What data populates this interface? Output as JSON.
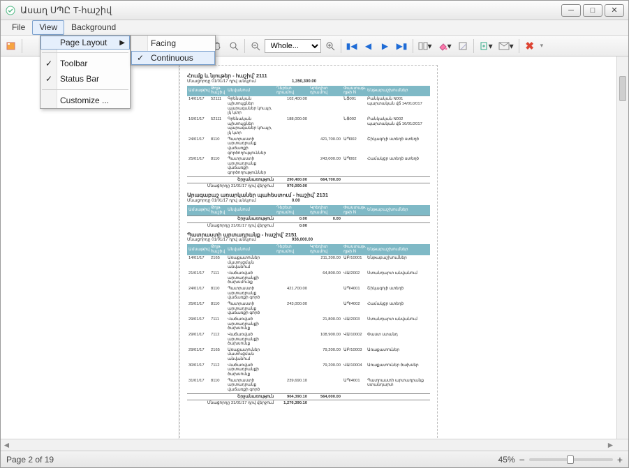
{
  "window": {
    "title": "Ասաղ ՍՊԸ T-հաշիվ"
  },
  "menubar": {
    "file": "File",
    "view": "View",
    "background": "Background"
  },
  "view_menu": {
    "page_layout": "Page Layout",
    "facing": "Facing",
    "continuous": "Continuous",
    "toolbar": "Toolbar",
    "statusbar": "Status Bar",
    "customize": "Customize ..."
  },
  "toolbar": {
    "zoom_select": "Whole...",
    "close_tooltip": "Close"
  },
  "statusbar": {
    "page_info": "Page 2 of 19",
    "zoom_pct": "45%"
  },
  "doc": {
    "sections": [
      {
        "title": "Հումք և նյութեր - հաշիվ՝ 2111",
        "opening_label": "Մնացորդը 01/01/17 դրվ անկյում",
        "opening_amount": "1,350,300.00",
        "headers": [
          "Ամսաթիվ",
          "Թղթ. հաշիվ",
          "Անվանում",
          "Դեբետ դրամով",
          "Կրեդիտ դրամով",
          "Փաստաթ. ղթի N",
          "Ենթաբաշխումներ"
        ],
        "rows": [
          {
            "date": "14/01/17",
            "acc": "52111",
            "name": "Գրենական պիտույքներ պարագաներ կուպր, լկ կտր",
            "debit": "102,400.00",
            "credit": "",
            "doc": "ՆՑ001",
            "sub": "Բանկական N001 պարտական վճ 14/01/2017"
          },
          {
            "date": "16/01/17",
            "acc": "52111",
            "name": "Գրենական պիտույքներ պարագաներ կուպր, լկ կտր",
            "debit": "188,000.00",
            "credit": "",
            "doc": "ՆՑ002",
            "sub": "Բանկական N002 պարտական վճ 16/01/2017"
          },
          {
            "date": "24/01/17",
            "acc": "8110",
            "name": "Պատրաստի արտադրանք վաճառքի գործողություններ",
            "debit": "",
            "credit": "421,700.00",
            "doc": "ԱՊ002",
            "sub": "Շիկագոյի ստեղծ ստեղծ"
          },
          {
            "date": "25/01/17",
            "acc": "8110",
            "name": "Պատրաստի արտադրանք վաճառքի գործողություններ",
            "debit": "",
            "credit": "243,000.00",
            "doc": "ԱՊ002",
            "sub": "Համակցր ստեղծ ստեղծ"
          }
        ],
        "totals_label": "Շրջանառություն",
        "t_debit": "290,400.00",
        "t_credit": "664,700.00",
        "closing_label": "Մնացորդը 31/01/17 դրվ վերջում",
        "closing_amount": "976,000.00"
      },
      {
        "title": "Արագաբաշ առարկաներ պահեստում - հաշիվ՝ 2131",
        "opening_label": "Մնացորդը 01/01/17 դրվ անկյում",
        "opening_amount": "0.00",
        "headers": [
          "Ամսաթիվ",
          "Թղթ. հաշիվ",
          "Անվանում",
          "Դեբետ դրամով",
          "Կրեդիտ դրամով",
          "Փաստաթ. ղթի N",
          "Ենթաբաշխումներ"
        ],
        "rows": [],
        "totals_label": "Շրջանառություն",
        "t_debit": "0.00",
        "t_credit": "0.00",
        "closing_label": "Մնացորդը 31/01/17 դրվ վերջում",
        "closing_amount": "0.00"
      },
      {
        "title": "Պատրաստի արտադրանք - հաշիվ՝ 2151",
        "opening_label": "Մնացորդը 01/01/17 դրվ անկյում",
        "opening_amount": "936,000.00",
        "headers": [
          "Ամսաթիվ",
          "Թղթ. հաշիվ",
          "Անվանում",
          "Դեբետ դրամով",
          "Կրեդիտ դրամով",
          "Փաստաթ. ղթի N",
          "Ենթաբաշխումներ"
        ],
        "rows": [
          {
            "date": "14/01/17",
            "acc": "2165",
            "name": "Առաքատուներ մատուցման անվանում",
            "debit": "",
            "credit": "211,200.00",
            "doc": "ԱԲ/10001",
            "sub": "Ենթաբաշխումներ"
          },
          {
            "date": "21/01/17",
            "acc": "7111",
            "name": "Վաճառված արտադրանքի ծախսմունք",
            "debit": "",
            "credit": "64,800.00",
            "doc": "ՎԱ/2002",
            "sub": "Ստանդարտ անվանում"
          },
          {
            "date": "24/01/17",
            "acc": "8110",
            "name": "Պատրաստի արտադրանք վաճառքի գործ",
            "debit": "421,700.00",
            "credit": "",
            "doc": "ԱՊ/4001",
            "sub": "Շիկագոյի ստեղծ"
          },
          {
            "date": "25/01/17",
            "acc": "8110",
            "name": "Պատրաստի արտադրանք վաճառքի գործ",
            "debit": "243,000.00",
            "credit": "",
            "doc": "ԱՊ/4002",
            "sub": "Համակցր ստեղծ"
          },
          {
            "date": "29/01/17",
            "acc": "7111",
            "name": "Վաճառված արտադրանքի ծախսունք",
            "debit": "",
            "credit": "21,800.00",
            "doc": "ՎԱ/2003",
            "sub": "Ստանդարտ անվանում"
          },
          {
            "date": "29/01/17",
            "acc": "7112",
            "name": "Վաճառված արտադրանքի ծախսունք",
            "debit": "",
            "credit": "108,900.00",
            "doc": "ՎԱ/10002",
            "sub": "Փաստ ստանդ"
          },
          {
            "date": "29/01/17",
            "acc": "2165",
            "name": "Առաքատուներ մատուցման անվանում",
            "debit": "",
            "credit": "79,200.00",
            "doc": "ԱԲ/10003",
            "sub": "Առաքատուներ"
          },
          {
            "date": "30/01/17",
            "acc": "7112",
            "name": "Վաճառված արտադրանքի ծախսունք",
            "debit": "",
            "credit": "79,200.00",
            "doc": "ՎԱ/10004",
            "sub": "Առաքատուներ ծախսեր"
          },
          {
            "date": "31/01/17",
            "acc": "8110",
            "name": "Պատրաստի արտադրանք վաճառքի գործ",
            "debit": "239,690.10",
            "credit": "",
            "doc": "ԱՊ/4001",
            "sub": "Պատրաստի արտադրանք ստանդարտ"
          }
        ],
        "totals_label": "Շրջանառություն",
        "t_debit": "904,390.10",
        "t_credit": "564,000.00",
        "closing_label": "Մնացորդը 31/01/17 դրվ վերջում",
        "closing_amount": "1,276,390.10"
      }
    ]
  }
}
